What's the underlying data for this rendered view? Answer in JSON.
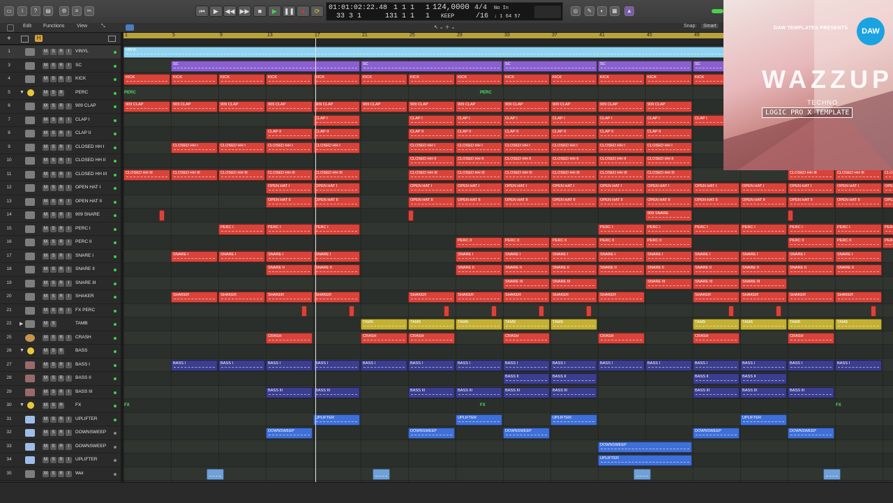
{
  "transport": {
    "time": "01:01:02:22.48",
    "time2": "33  3  1",
    "bars_a": "1  1  1",
    "bars_b": "131  1  1",
    "beat_a": "1",
    "beat_b": "3",
    "bar_a": "1",
    "bar_b": "1",
    "tempo": "124,0000",
    "tempo_label": "KEEP",
    "sig": "4/4",
    "div": "/16",
    "input": "No In",
    "output": "↓ 1  64  57"
  },
  "menu": {
    "edit": "Edit",
    "functions": "Functions",
    "view": "View",
    "snap_label": "Snap:",
    "snap_value": "Smart"
  },
  "ruler": [
    "1",
    "5",
    "9",
    "13",
    "17",
    "21",
    "25",
    "29",
    "33",
    "37",
    "41",
    "45",
    "49",
    "53",
    "57",
    "61",
    "65",
    "69",
    "73",
    "77",
    "81",
    "85",
    "89",
    "93",
    "97",
    "101"
  ],
  "tracks": [
    {
      "num": "1",
      "name": "VINYL",
      "color": "#5fc9f0",
      "icon": "audio-track-icon"
    },
    {
      "num": "3",
      "name": "SC",
      "color": "#8a5fd0",
      "icon": "audio-track-icon"
    },
    {
      "num": "4",
      "name": "KICK",
      "color": "#e04a3c",
      "icon": "audio-track-icon"
    },
    {
      "num": "5",
      "name": "PERC",
      "color": "#3ed34a",
      "icon": "folder-icon"
    },
    {
      "num": "6",
      "name": "909 CLAP",
      "color": "#e04a3c",
      "icon": "audio-track-icon"
    },
    {
      "num": "7",
      "name": "CLAP I",
      "color": "#e04a3c",
      "icon": "audio-track-icon"
    },
    {
      "num": "8",
      "name": "CLAP II",
      "color": "#e04a3c",
      "icon": "audio-track-icon"
    },
    {
      "num": "9",
      "name": "CLOSED HH I",
      "color": "#e04a3c",
      "icon": "audio-track-icon"
    },
    {
      "num": "10",
      "name": "CLOSED HH II",
      "color": "#e04a3c",
      "icon": "audio-track-icon"
    },
    {
      "num": "11",
      "name": "CLOSED HH III",
      "color": "#e04a3c",
      "icon": "audio-track-icon"
    },
    {
      "num": "12",
      "name": "OPEN HAT I",
      "color": "#e04a3c",
      "icon": "audio-track-icon"
    },
    {
      "num": "13",
      "name": "OPEN HAT II",
      "color": "#e04a3c",
      "icon": "audio-track-icon"
    },
    {
      "num": "14",
      "name": "909 SNARE",
      "color": "#e04a3c",
      "icon": "audio-track-icon"
    },
    {
      "num": "15",
      "name": "PERC I",
      "color": "#e04a3c",
      "icon": "audio-track-icon"
    },
    {
      "num": "16",
      "name": "PERC II",
      "color": "#e04a3c",
      "icon": "audio-track-icon"
    },
    {
      "num": "17",
      "name": "SNARE I",
      "color": "#e04a3c",
      "icon": "audio-track-icon"
    },
    {
      "num": "18",
      "name": "SNARE II",
      "color": "#e04a3c",
      "icon": "audio-track-icon"
    },
    {
      "num": "19",
      "name": "SNARE III",
      "color": "#e04a3c",
      "icon": "audio-track-icon"
    },
    {
      "num": "20",
      "name": "SHAKER",
      "color": "#e04a3c",
      "icon": "audio-track-icon"
    },
    {
      "num": "21",
      "name": "FX PERC",
      "color": "#e04a3c",
      "icon": "audio-track-icon"
    },
    {
      "num": "22",
      "name": "TAMB",
      "color": "#c4b033",
      "icon": "folder-icon"
    },
    {
      "num": "25",
      "name": "CRASH",
      "color": "#e04a3c",
      "icon": "cymbal-icon"
    },
    {
      "num": "26",
      "name": "BASS",
      "color": "#3ed34a",
      "icon": "folder-icon"
    },
    {
      "num": "27",
      "name": "BASS I",
      "color": "#3b3d8f",
      "icon": "instrument-icon"
    },
    {
      "num": "28",
      "name": "BASS II",
      "color": "#3b3d8f",
      "icon": "instrument-icon"
    },
    {
      "num": "29",
      "name": "BASS III",
      "color": "#3b3d8f",
      "icon": "instrument-icon"
    },
    {
      "num": "30",
      "name": "FX",
      "color": "#3ed34a",
      "icon": "folder-icon"
    },
    {
      "num": "31",
      "name": "UPLIFTER",
      "color": "#3f6fd8",
      "icon": "fx-icon"
    },
    {
      "num": "32",
      "name": "DOWNSWEEP",
      "color": "#3f6fd8",
      "icon": "fx-icon"
    },
    {
      "num": "33",
      "name": "DOWNSWEEP",
      "color": "#3f6fd8",
      "icon": "fx-icon"
    },
    {
      "num": "34",
      "name": "UPLIFTER",
      "color": "#3f6fd8",
      "icon": "fx-icon"
    },
    {
      "num": "35",
      "name": "Wet",
      "color": "#6fa0d8",
      "icon": "aux-icon"
    }
  ],
  "artwork": {
    "brand": "DAW TEMPLATES PRESENTS",
    "logo": "DAW",
    "title": "WAZZUP",
    "genre": "TECHNO",
    "subtitle": "LOGIC PRO X TEMPLATE"
  }
}
